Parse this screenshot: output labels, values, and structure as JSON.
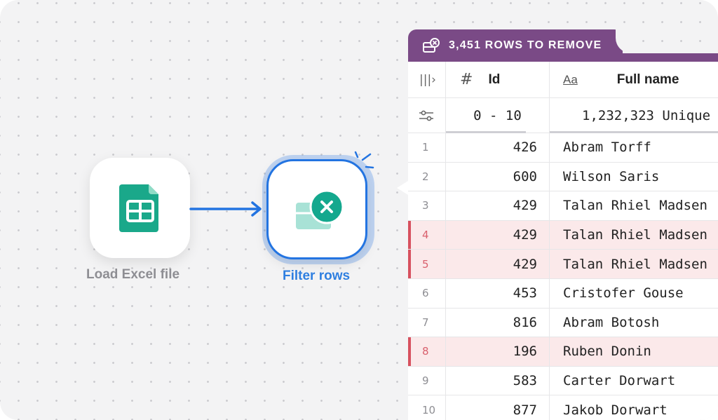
{
  "pipeline": {
    "nodes": [
      {
        "label": "Load Excel file",
        "icon": "spreadsheet-icon"
      },
      {
        "label": "Filter rows",
        "icon": "filter-remove-icon"
      }
    ]
  },
  "table": {
    "banner": "3,451 ROWS TO REMOVE",
    "columns": [
      {
        "type_glyph": "#",
        "name": "Id"
      },
      {
        "type_glyph": "Aa",
        "name": "Full name"
      }
    ],
    "stats": {
      "id_range": "0 - 10",
      "name_unique": "1,232,323 Unique"
    },
    "rows": [
      {
        "index": "1",
        "id": "426",
        "name": "Abram Torff",
        "removed": false
      },
      {
        "index": "2",
        "id": "600",
        "name": "Wilson Saris",
        "removed": false
      },
      {
        "index": "3",
        "id": "429",
        "name": "Talan Rhiel Madsen",
        "removed": false
      },
      {
        "index": "4",
        "id": "429",
        "name": "Talan Rhiel Madsen",
        "removed": true
      },
      {
        "index": "5",
        "id": "429",
        "name": "Talan Rhiel Madsen",
        "removed": true
      },
      {
        "index": "6",
        "id": "453",
        "name": "Cristofer Gouse",
        "removed": false
      },
      {
        "index": "7",
        "id": "816",
        "name": "Abram Botosh",
        "removed": false
      },
      {
        "index": "8",
        "id": "196",
        "name": "Ruben Donin",
        "removed": true
      },
      {
        "index": "9",
        "id": "583",
        "name": "Carter Dorwart",
        "removed": false
      },
      {
        "index": "10",
        "id": "877",
        "name": "Jakob Dorwart",
        "removed": false
      }
    ]
  },
  "colors": {
    "accent": "#2374e1",
    "banner": "#7a4a86",
    "removed_row": "#fbe9ea",
    "removed_marker": "#d7515f",
    "excel_green": "#16a085"
  }
}
